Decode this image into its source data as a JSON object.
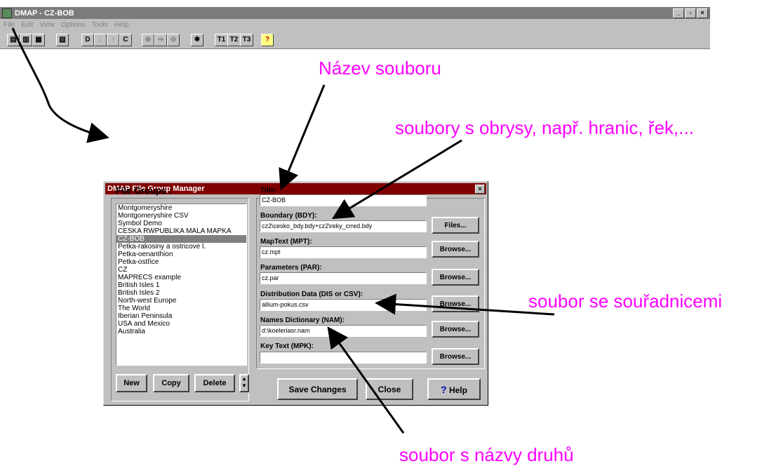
{
  "app": {
    "title": "DMAP - CZ-BOB",
    "menu": [
      "File",
      "Edit",
      "View",
      "Options",
      "Tools",
      "Help"
    ],
    "toolbar_text_buttons": [
      "D",
      "C",
      "T1",
      "T2",
      "T3",
      "?"
    ],
    "window_controls": [
      "_",
      "▫",
      "×"
    ]
  },
  "annotations": {
    "file_name": "Název souboru",
    "boundary_files": "soubory s obrysy, např. hranic, řek,...",
    "coordinates_file": "soubor se souřadnicemi",
    "species_names_file": "soubor s názvy druhů",
    "color": "#ff00ff"
  },
  "dialog": {
    "title": "DMAP File Group Manager",
    "close_label": "×",
    "groups_heading": "File Groups :",
    "groups": [
      "Montgomeryshire",
      "Montgomeryshire CSV",
      "Symbol Demo",
      "CESKA RWPUBLIKA MALA MAPKA",
      "CZ-BOB",
      "Petka-rakosiny a ostricove l.",
      "Petka-oenanthion",
      "Petka-ostřice",
      "CZ",
      "MAPRECS example",
      "British Isles 1",
      "British Isles 2",
      "North-west Europe",
      "The World",
      "Iberian Peninsula",
      "USA and Mexico",
      "Australia"
    ],
    "selected_group": "CZ-BOB",
    "buttons": {
      "new": "New",
      "copy": "Copy",
      "delete": "Delete",
      "save": "Save Changes",
      "close": "Close",
      "help": "Help",
      "files": "Files...",
      "browse": "Browse..."
    },
    "fields": {
      "title": {
        "label": "Title:",
        "value": "CZ-BOB"
      },
      "boundary": {
        "label": "Boundary (BDY):",
        "value": "cz2\\cesko_bdy.bdy+cz2\\reky_crred.bdy"
      },
      "maptext": {
        "label": "MapText (MPT):",
        "value": "cz.mpt"
      },
      "parameters": {
        "label": "Parameters (PAR):",
        "value": "cz.par"
      },
      "distribution": {
        "label": "Distribution Data (DIS or CSV):",
        "value": "allium-pokus.csv"
      },
      "names": {
        "label": "Names Dictionary (NAM):",
        "value": "d:\\koeleriasr.nam"
      },
      "keytext": {
        "label": "Key Text (MPK):",
        "value": ""
      }
    },
    "colors": {
      "titlebar": "#800000",
      "face": "#c0c0c0",
      "selection": "#808080"
    }
  }
}
